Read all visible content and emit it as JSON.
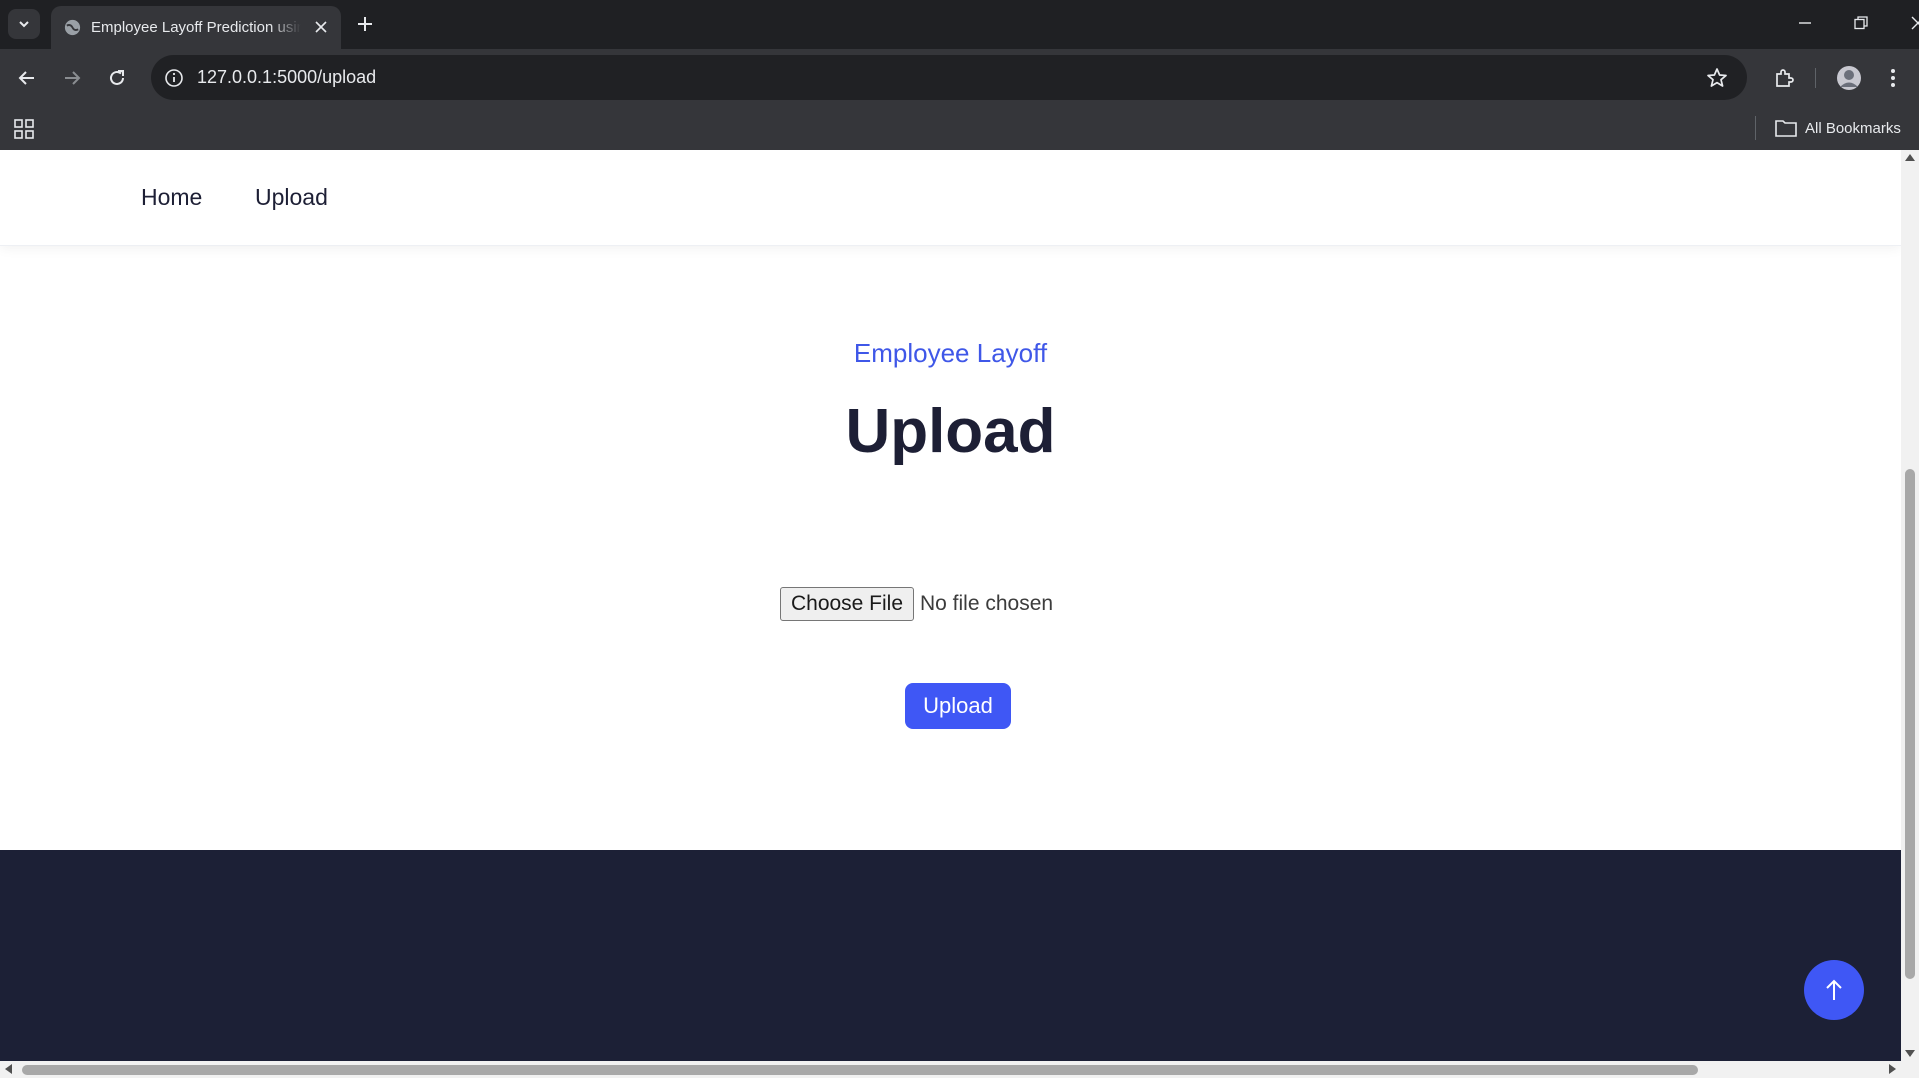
{
  "browser": {
    "tab_title": "Employee Layoff Prediction using",
    "url": "127.0.0.1:5000/upload",
    "bookmarks_label": "All Bookmarks"
  },
  "site": {
    "nav": [
      {
        "label": "Home"
      },
      {
        "label": "Upload"
      }
    ],
    "subtitle": "Employee Layoff",
    "title": "Upload",
    "file_button": "Choose File",
    "file_status": "No file chosen",
    "upload_button": "Upload"
  },
  "colors": {
    "accent": "#3f57f5",
    "heading": "#1d1f35",
    "footer": "#1c2036"
  }
}
